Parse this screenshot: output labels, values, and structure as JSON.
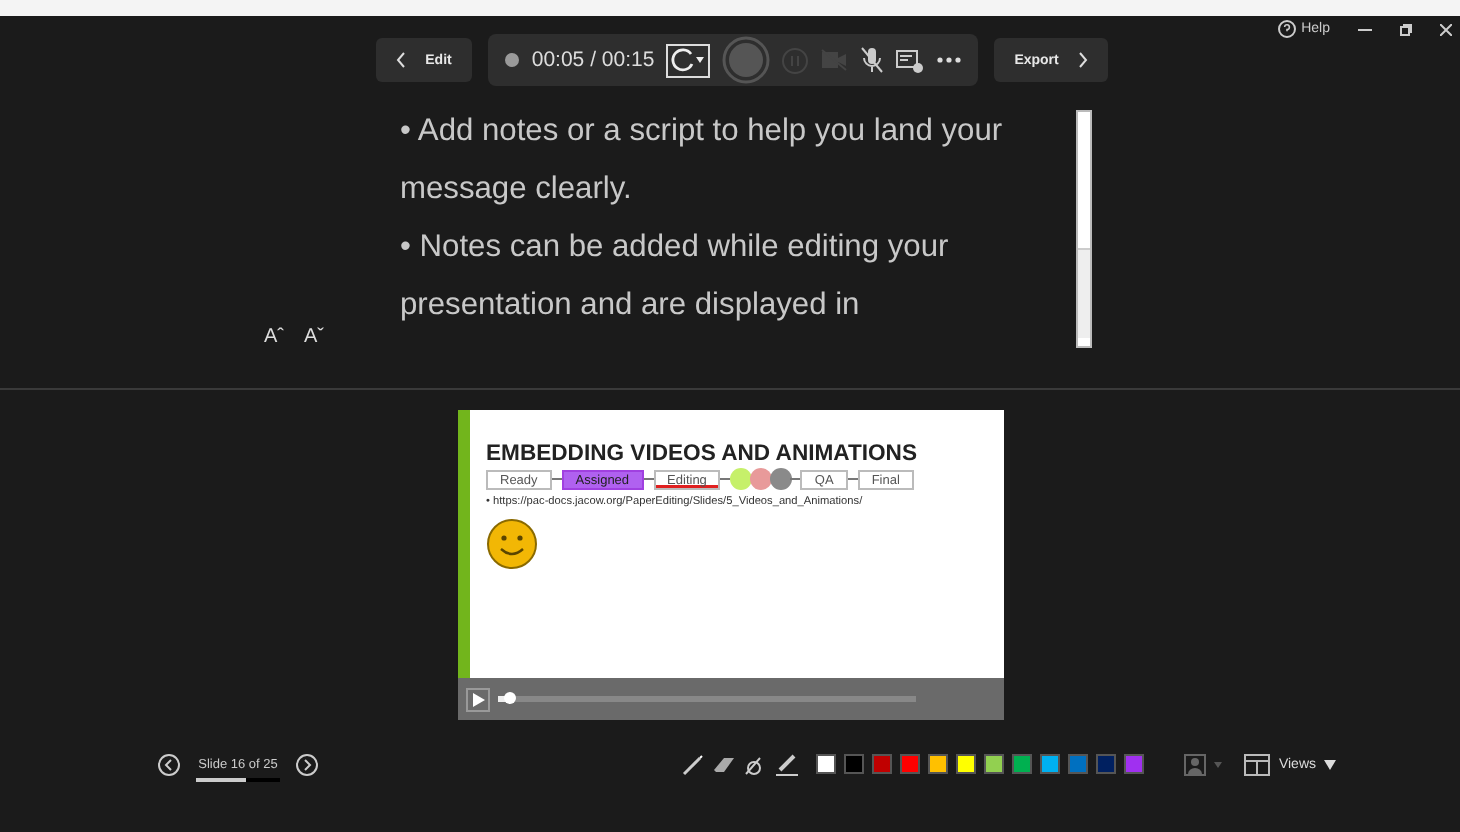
{
  "toolbar": {
    "edit_button": "Edit",
    "timer": "00:05 / 00:15",
    "export_button": "Export"
  },
  "window_controls": {
    "help": "Help"
  },
  "notes": {
    "paragraphs": [
      "• Add notes or a script to help you land your message clearly.",
      "• Notes can be added while editing your presentation and are displayed in"
    ],
    "increase_font": "Aˆ",
    "decrease_font": "Aˇ"
  },
  "slide": {
    "title": "EMBEDDING VIDEOS AND ANIMATIONS",
    "workflow": [
      {
        "kind": "step",
        "label": "Ready",
        "selected": false,
        "underlined": false
      },
      {
        "kind": "step",
        "label": "Assigned",
        "selected": true,
        "underlined": false
      },
      {
        "kind": "step",
        "label": "Editing",
        "selected": false,
        "underlined": true
      },
      {
        "kind": "dot",
        "color": "#c6f06a"
      },
      {
        "kind": "dot",
        "color": "#e89a9a"
      },
      {
        "kind": "dot",
        "color": "#8a8a8a"
      },
      {
        "kind": "step",
        "label": "QA",
        "selected": false,
        "underlined": false
      },
      {
        "kind": "step",
        "label": "Final",
        "selected": false,
        "underlined": false
      }
    ],
    "bullet": "• https://pac-docs.jacow.org/PaperEditing/Slides/5_Videos_and_Animations/",
    "video": {
      "level": 0.03
    }
  },
  "navigation": {
    "slide_counter": "Slide 16 of 25",
    "level": 0.6
  },
  "ink_colors": [
    {
      "color": "#ffffff"
    },
    {
      "color": "#000000"
    },
    {
      "color": "#c00000"
    },
    {
      "color": "#ff0000"
    },
    {
      "color": "#ffc000"
    },
    {
      "color": "#ffff00"
    },
    {
      "color": "#92d050"
    },
    {
      "color": "#00b050"
    },
    {
      "color": "#00b0f0"
    },
    {
      "color": "#0070c0"
    },
    {
      "color": "#002060"
    },
    {
      "color": "#a030f0"
    }
  ],
  "views_button": "Views"
}
